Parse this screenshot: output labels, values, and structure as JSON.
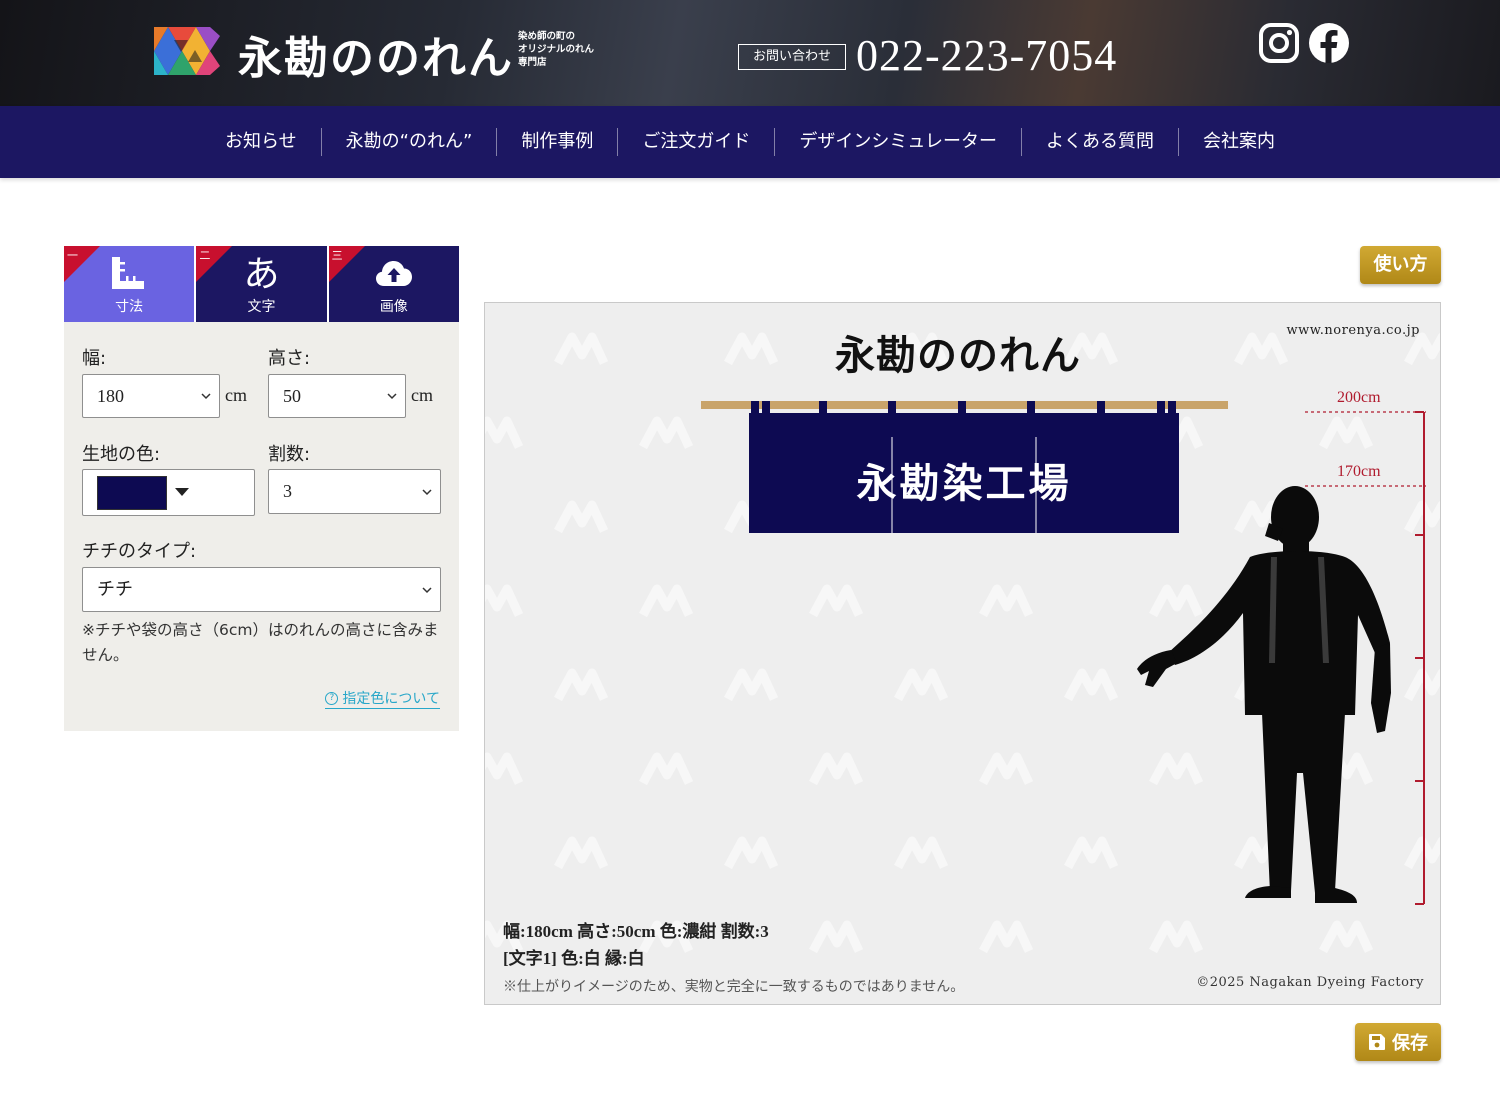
{
  "brand": {
    "name": "永勘ののれん",
    "tagline": [
      "染め師の町の",
      "オリジナルのれん",
      "専門店"
    ]
  },
  "header": {
    "contact_label": "お問い合わせ",
    "phone": "022-223-7054",
    "social": [
      {
        "icon": "instagram-icon"
      },
      {
        "icon": "facebook-icon"
      }
    ]
  },
  "nav": {
    "items": [
      "お知らせ",
      "永勘の“のれん”",
      "制作事例",
      "ご注文ガイド",
      "デザインシミュレーター",
      "よくある質問",
      "会社案内"
    ]
  },
  "tabs": [
    {
      "num": "一",
      "label": "寸法",
      "icon": "ruler-icon",
      "active": true
    },
    {
      "num": "二",
      "label": "文字",
      "icon_text": "あ",
      "icon": "hiragana-icon",
      "active": false
    },
    {
      "num": "三",
      "label": "画像",
      "icon": "cloud-upload-icon",
      "active": false
    }
  ],
  "form": {
    "width_label": "幅:",
    "width_value": "180",
    "width_unit": "cm",
    "height_label": "高さ:",
    "height_value": "50",
    "height_unit": "cm",
    "color_label": "生地の色:",
    "color_value": "#0d0a52",
    "split_label": "割数:",
    "split_value": "3",
    "chichi_label": "チチのタイプ:",
    "chichi_value": "チチ",
    "note": "※チチや袋の高さ（6cm）はのれんの高さに含みません。",
    "color_link": "指定色について"
  },
  "preview": {
    "howto_label": "使い方",
    "title": "永勘ののれん",
    "url": "www.norenya.co.jp",
    "noren_text": "永勘染工場",
    "measure_labels": [
      "200cm",
      "170cm"
    ],
    "spec_line1": "幅:180cm  高さ:50cm  色:濃紺  割数:3",
    "spec_line2": "[文字1]  色:白  縁:白",
    "disclaimer": "※仕上がりイメージのため、実物と完全に一致するものではありません。",
    "copyright": "©2025 Nagakan Dyeing Factory",
    "noren_color": "#0d0a52",
    "rod_color": "#c9a46a",
    "measure_color": "#b01b2e"
  },
  "save_label": "保存"
}
